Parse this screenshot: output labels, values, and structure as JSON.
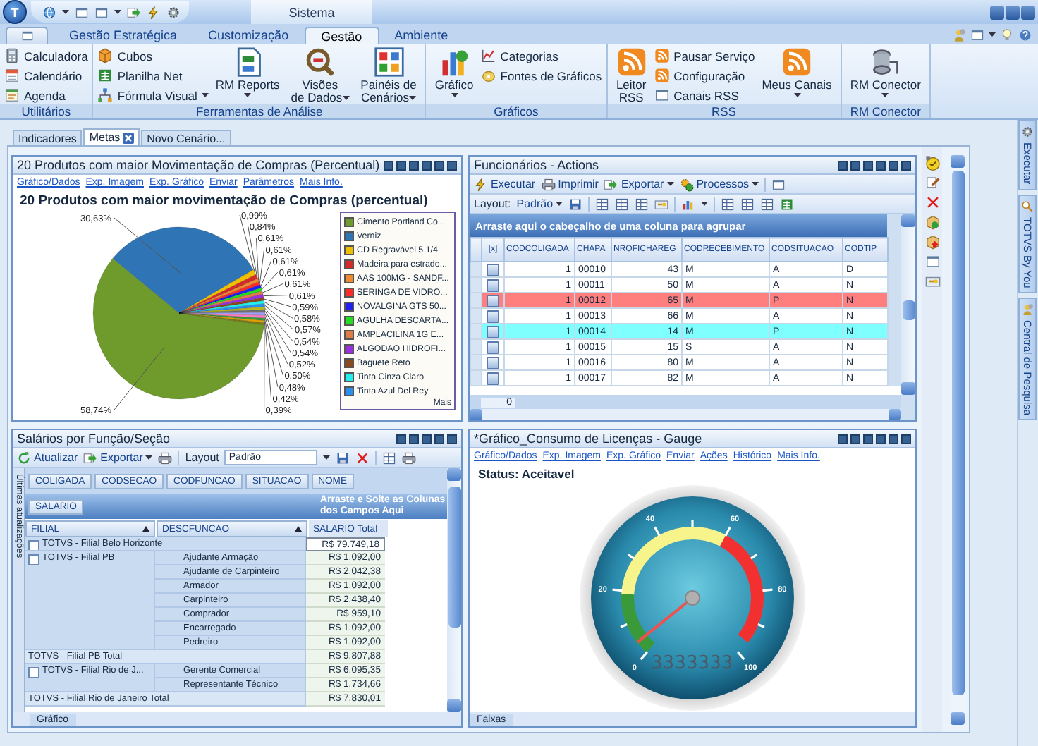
{
  "window": {
    "orb": "T",
    "title": "Sistema"
  },
  "ribbon": {
    "tabs": [
      {
        "label": "Gestão Estratégica",
        "selected": false
      },
      {
        "label": "Customização",
        "selected": false
      },
      {
        "label": "Gestão",
        "selected": true
      },
      {
        "label": "Ambiente",
        "selected": false
      }
    ],
    "groups": [
      {
        "label": "Utilitários",
        "items": [
          {
            "kind": "stack",
            "buttons": [
              {
                "label": "Calculadora",
                "dropdown": false
              },
              {
                "label": "Calendário",
                "dropdown": false
              },
              {
                "label": "Agenda",
                "dropdown": false
              }
            ]
          }
        ]
      },
      {
        "label": "Ferramentas de Análise",
        "items": [
          {
            "kind": "stack",
            "buttons": [
              {
                "label": "Cubos",
                "dropdown": false
              },
              {
                "label": "Planilha Net",
                "dropdown": false
              },
              {
                "label": "Fórmula Visual",
                "dropdown": true
              }
            ]
          },
          {
            "kind": "large",
            "lines": [
              "RM Reports"
            ],
            "dropdown": true
          },
          {
            "kind": "large",
            "lines": [
              "Visões",
              "de Dados"
            ],
            "dropdown": true
          },
          {
            "kind": "large",
            "lines": [
              "Painéis de",
              "Cenários"
            ],
            "dropdown": true
          }
        ]
      },
      {
        "label": "Gráficos",
        "items": [
          {
            "kind": "large",
            "lines": [
              "Gráfico"
            ],
            "dropdown": true
          },
          {
            "kind": "stack",
            "buttons": [
              {
                "label": "Categorias",
                "dropdown": false
              },
              {
                "label": "Fontes de Gráficos",
                "dropdown": false
              }
            ]
          }
        ]
      },
      {
        "label": "RSS",
        "items": [
          {
            "kind": "large",
            "lines": [
              "Leitor",
              "RSS"
            ],
            "dropdown": false
          },
          {
            "kind": "stack",
            "buttons": [
              {
                "label": "Pausar Serviço",
                "dropdown": false
              },
              {
                "label": "Configuração",
                "dropdown": false
              },
              {
                "label": "Canais RSS",
                "dropdown": false
              }
            ]
          },
          {
            "kind": "large",
            "lines": [
              "Meus Canais"
            ],
            "dropdown": true
          }
        ]
      },
      {
        "label": "RM Conector",
        "items": [
          {
            "kind": "large",
            "lines": [
              "RM Conector"
            ],
            "dropdown": true
          }
        ]
      }
    ]
  },
  "document_tabs": [
    {
      "label": "Indicadores",
      "selected": false,
      "closable": false
    },
    {
      "label": "Metas",
      "selected": true,
      "closable": true
    },
    {
      "label": "Novo Cenário...",
      "selected": false,
      "closable": false
    }
  ],
  "chart_panel": {
    "title": "20 Produtos com maior Movimentação de Compras (Percentual)",
    "links": [
      "Gráfico/Dados",
      "Exp. Imagem",
      "Exp. Gráfico",
      "Enviar",
      "Parâmetros",
      "Mais Info."
    ],
    "chart_data": {
      "type": "pie",
      "title": "20 Produtos com maior movimentação de Compras (percentual)",
      "values": [
        58.74,
        30.63,
        0.99,
        0.84,
        0.61,
        0.61,
        0.61,
        0.61,
        0.61,
        0.61,
        0.59,
        0.58,
        0.57,
        0.54,
        0.54,
        0.52,
        0.5,
        0.48,
        0.42,
        0.39
      ],
      "value_labels": [
        "58,74%",
        "30,63%",
        "0,99%",
        "0,84%",
        "0,61%",
        "0,61%",
        "0,61%",
        "0,61%",
        "0,61%",
        "0,61%",
        "0,59%",
        "0,58%",
        "0,57%",
        "0,54%",
        "0,54%",
        "0,52%",
        "0,50%",
        "0,48%",
        "0,42%",
        "0,39%"
      ],
      "colors": [
        "#6e9b2c",
        "#2f74b5",
        "#f0c000",
        "#d42a2a",
        "#f08a30",
        "#ff2a2a",
        "#2020f0",
        "#22dd22",
        "#e07a48",
        "#9a30e0",
        "#8a4a20",
        "#22eeee",
        "#2a90f0",
        "#b8b820",
        "#707070",
        "#a0a0ff",
        "#ff80c0",
        "#3a9a3a",
        "#e0a000",
        "#7a7a10"
      ],
      "data_labels": true
    },
    "legend": {
      "items": [
        {
          "label": "Cimento Portland Co...",
          "color": "#6e9b2c"
        },
        {
          "label": "Verniz",
          "color": "#2f74b5"
        },
        {
          "label": "CD Regravável 5 1/4",
          "color": "#f0c000"
        },
        {
          "label": "Madeira para estrado...",
          "color": "#d42a2a"
        },
        {
          "label": "AAS 100MG - SANDF...",
          "color": "#f08a30"
        },
        {
          "label": "SERINGA DE VIDRO...",
          "color": "#ff2a2a"
        },
        {
          "label": "NOVALGINA GTS 50...",
          "color": "#2020f0"
        },
        {
          "label": "AGULHA DESCARTA...",
          "color": "#22dd22"
        },
        {
          "label": "AMPLACILINA 1G E...",
          "color": "#e07a48"
        },
        {
          "label": "ALGODAO HIDROFI...",
          "color": "#9a30e0"
        },
        {
          "label": "Baguete Reto",
          "color": "#8a4a20"
        },
        {
          "label": "Tinta Cinza Claro",
          "color": "#22eeee"
        },
        {
          "label": "Tinta Azul Del Rey",
          "color": "#2a90f0"
        }
      ],
      "more": "Mais"
    }
  },
  "employees_panel": {
    "title": "Funcionários - Actions",
    "toolbar": [
      {
        "label": "Executar",
        "dropdown": false
      },
      {
        "label": "Imprimir",
        "dropdown": false
      },
      {
        "label": "Exportar",
        "dropdown": true
      },
      {
        "label": "Processos",
        "dropdown": true
      }
    ],
    "layout_label": "Layout:",
    "layout_value": "Padrão",
    "group_hint": "Arraste aqui o cabeçalho de uma coluna para agrupar",
    "select_header": "[x]",
    "columns": [
      "CODCOLIGADA",
      "CHAPA",
      "NROFICHAREG",
      "CODRECEBIMENTO",
      "CODSITUACAO",
      "CODTIP"
    ],
    "rows": [
      {
        "checked": false,
        "color": "#ffffff",
        "cells": [
          "1",
          "00010",
          "43",
          "M",
          "A",
          "D"
        ]
      },
      {
        "checked": false,
        "color": "#ffffff",
        "cells": [
          "1",
          "00011",
          "50",
          "M",
          "A",
          "N"
        ]
      },
      {
        "checked": false,
        "color": "#ff7f7f",
        "cells": [
          "1",
          "00012",
          "65",
          "M",
          "P",
          "N"
        ]
      },
      {
        "checked": false,
        "color": "#ffffff",
        "cells": [
          "1",
          "00013",
          "66",
          "M",
          "A",
          "N"
        ]
      },
      {
        "checked": false,
        "color": "#80ffff",
        "cells": [
          "1",
          "00014",
          "14",
          "M",
          "P",
          "N"
        ]
      },
      {
        "checked": false,
        "color": "#ffffff",
        "cells": [
          "1",
          "00015",
          "15",
          "S",
          "A",
          "N"
        ]
      },
      {
        "checked": false,
        "color": "#ffffff",
        "cells": [
          "1",
          "00016",
          "80",
          "M",
          "A",
          "N"
        ]
      },
      {
        "checked": false,
        "color": "#ffffff",
        "cells": [
          "1",
          "00017",
          "82",
          "M",
          "A",
          "N"
        ]
      }
    ],
    "footer": "0"
  },
  "salary_panel": {
    "title": "Salários por Função/Seção",
    "toolbar": [
      {
        "label": "Atualizar",
        "dropdown": false
      },
      {
        "label": "Exportar",
        "dropdown": true
      }
    ],
    "layout_label": "Layout",
    "layout_value": "Padrão",
    "side_tab": "Últimas atualizações",
    "filter_fields": [
      "COLIGADA",
      "CODSECAO",
      "CODFUNCAO",
      "SITUACAO",
      "NOME"
    ],
    "data_field": "SALARIO",
    "drop_hint": "Arraste e Solte as Colunas dos Campos Aqui",
    "row_fields": [
      "FILIAL",
      "DESCFUNCAO"
    ],
    "value_header": "SALARIO Total",
    "rows": [
      {
        "kind": "group",
        "filial": "TOTVS - Filial Belo Horizonte",
        "value": "R$ 79.749,18",
        "selected": true
      },
      {
        "kind": "item",
        "filial": "TOTVS - Filial PB",
        "funcao": "Ajudante  Armação",
        "value": "R$ 1.092,00",
        "selected": false
      },
      {
        "kind": "item",
        "funcao": "Ajudante de Carpinteiro",
        "value": "R$ 2.042,38",
        "selected": false
      },
      {
        "kind": "item",
        "funcao": "Armador",
        "value": "R$ 1.092,00",
        "selected": false
      },
      {
        "kind": "item",
        "funcao": "Carpinteiro",
        "value": "R$ 2.438,40",
        "selected": false
      },
      {
        "kind": "item",
        "funcao": "Comprador",
        "value": "R$ 959,10",
        "selected": false
      },
      {
        "kind": "item",
        "funcao": "Encarregado",
        "value": "R$ 1.092,00",
        "selected": false
      },
      {
        "kind": "item",
        "funcao": "Pedreiro",
        "value": "R$ 1.092,00",
        "selected": false
      },
      {
        "kind": "total",
        "filial": "TOTVS - Filial PB Total",
        "value": "R$ 9.807,88",
        "selected": false
      },
      {
        "kind": "item",
        "filial": "TOTVS - Filial Rio de J...",
        "funcao": "Gerente Comercial",
        "value": "R$ 6.095,35",
        "selected": false
      },
      {
        "kind": "item",
        "funcao": "Representante Técnico",
        "value": "R$ 1.734,66",
        "selected": false
      },
      {
        "kind": "total",
        "filial": "TOTVS - Filial Rio de Janeiro Total",
        "value": "R$ 7.830,01",
        "selected": false
      }
    ],
    "bottom_tab": "Gráfico"
  },
  "gauge_panel": {
    "title": "*Gráfico_Consumo de Licenças - Gauge",
    "links": [
      "Gráfico/Dados",
      "Exp. Imagem",
      "Exp. Gráfico",
      "Enviar",
      "Ações",
      "Histórico",
      "Mais Info."
    ],
    "status": "Status: Aceitavel",
    "ticks": [
      "0",
      "20",
      "40",
      "60",
      "80",
      "100"
    ],
    "readout": "3333333",
    "bottom_tab": "Faixas"
  },
  "dock_tabs": [
    "Executar",
    "TOTVS By You",
    "Central de Pesquisa"
  ]
}
